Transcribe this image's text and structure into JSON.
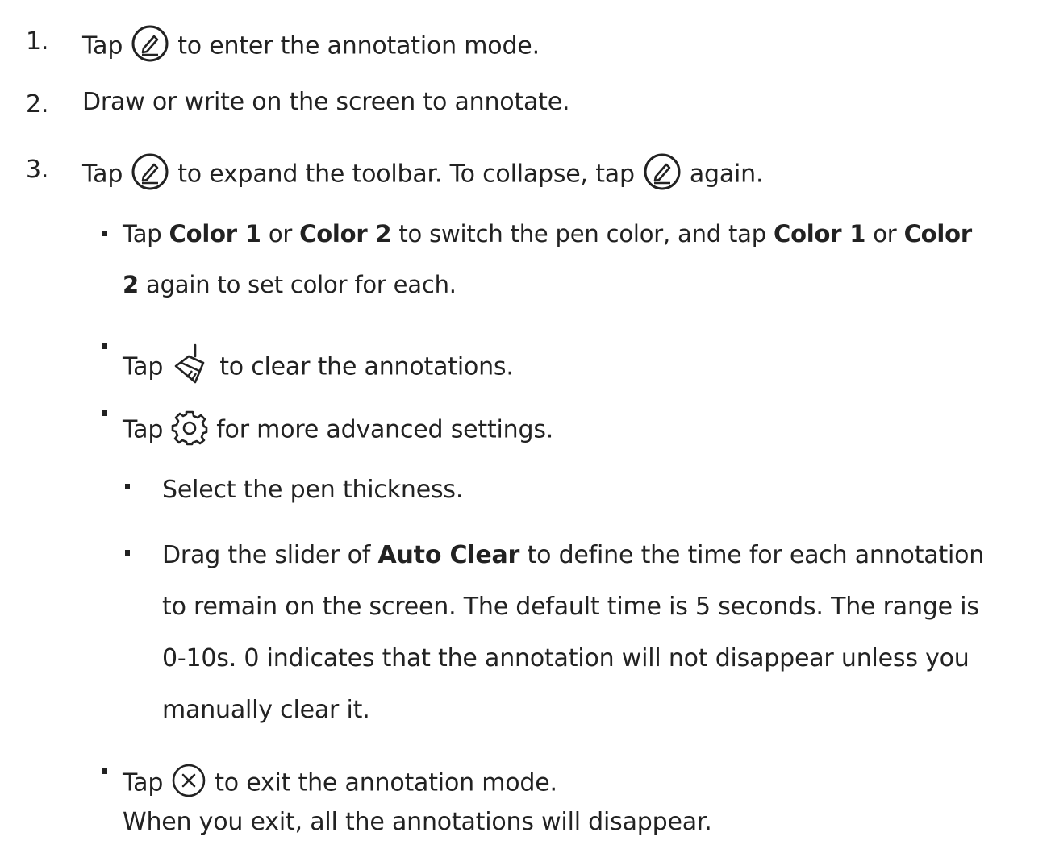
{
  "steps": [
    {
      "number": "1.",
      "before": "Tap",
      "icon": "pen-circle-icon",
      "after": "to enter the annotation mode."
    },
    {
      "number": "2.",
      "text": "Draw or write on the screen to annotate."
    },
    {
      "number": "3.",
      "before": "Tap",
      "icon": "pen-circle-icon",
      "middle": "to expand the toolbar. To collapse, tap",
      "icon2": "pen-circle-icon",
      "after": "again."
    }
  ],
  "bullets": {
    "color": {
      "t1": "Tap",
      "c1": "Color 1",
      "or1": "or",
      "c2": "Color 2",
      "t2": "to switch the pen color, and tap",
      "c3": "Color 1",
      "or2": "or",
      "c4a": "Color",
      "c4b": "2",
      "t3": "again to set color for each."
    },
    "clear": {
      "before": "Tap",
      "icon": "broom-icon",
      "after": "to clear the annotations."
    },
    "settings": {
      "before": "Tap",
      "icon": "gear-icon",
      "after": "for more advanced settings."
    },
    "sub": {
      "thickness": "Select the pen thickness.",
      "auto_clear": {
        "t1": "Drag the slider of",
        "bold": "Auto Clear",
        "t2": "to define the time for each annotation",
        "line2": "to remain on the screen. The default time is 5 seconds. The range is",
        "line3": "0-10s. 0 indicates that the annotation will not disappear unless you",
        "line4": "manually clear it."
      }
    },
    "exit": {
      "before": "Tap",
      "icon": "close-circle-icon",
      "after": "to exit the annotation mode.",
      "note": "When you exit, all the annotations will disappear."
    }
  }
}
